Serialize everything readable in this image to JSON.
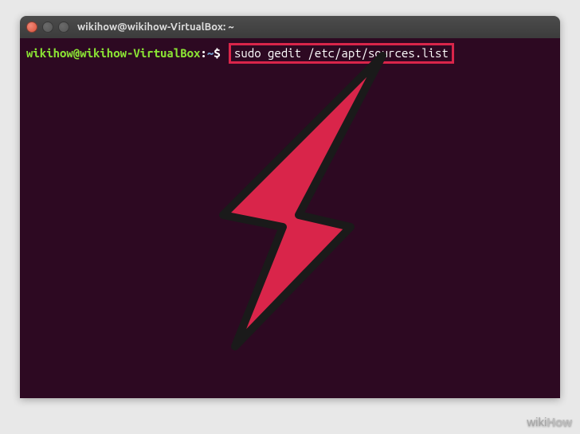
{
  "window": {
    "title": "wikihow@wikihow-VirtualBox: ~"
  },
  "prompt": {
    "user_host": "wikihow@wikihow-VirtualBox",
    "separator": ":",
    "path": "~",
    "symbol": "$"
  },
  "command": "sudo gedit /etc/apt/sources.list",
  "watermark": {
    "part1": "wiki",
    "part2": "How"
  },
  "colors": {
    "terminal_bg": "#2d0922",
    "prompt_user": "#8ae234",
    "prompt_path": "#729fcf",
    "highlight_border": "#d9254a",
    "arrow_fill": "#d9254a"
  }
}
